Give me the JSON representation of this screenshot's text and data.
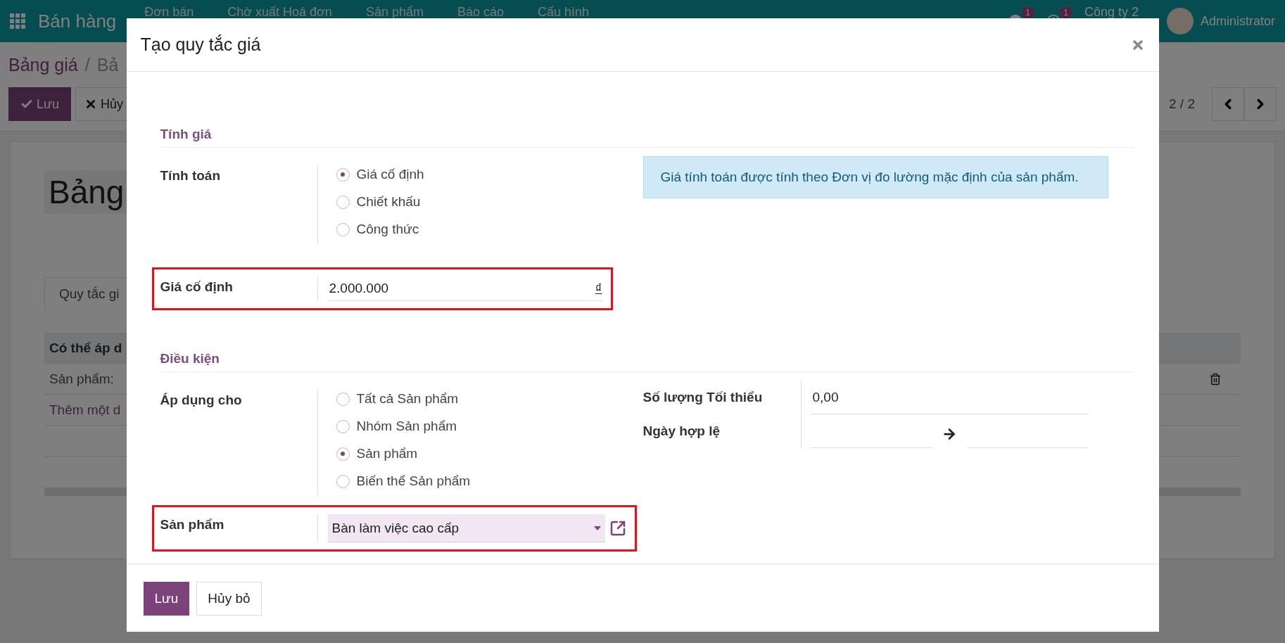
{
  "navbar": {
    "app_name": "Bán hàng",
    "menu": [
      "Đơn bán",
      "Chờ xuất Hoá đơn",
      "Sản phẩm",
      "Báo cáo",
      "Cấu hình"
    ],
    "chat_badge": "1",
    "activity_badge": "1",
    "company": "Công ty 2",
    "user": "Administrator"
  },
  "background": {
    "breadcrumb": [
      "Bảng giá",
      "/",
      "Bả"
    ],
    "buttons": [
      {
        "label": "Lưu",
        "kind": "primary"
      },
      {
        "label": "Hủy",
        "kind": "secondary"
      }
    ],
    "pager": "2 / 2",
    "title": "Bảng",
    "tab": "Quy tắc gi",
    "table": {
      "column_1": "Có thể áp d",
      "rows": [
        "Sản phẩm:"
      ],
      "add_line": "Thêm một d"
    }
  },
  "dialog": {
    "title": "Tạo quy tắc giá",
    "pricing": {
      "title": "Tính giá",
      "compute": {
        "label": "Tính toán",
        "options": [
          {
            "label": "Giá cố định",
            "selected": true
          },
          {
            "label": "Chiết khấu",
            "selected": false
          },
          {
            "label": "Công thức",
            "selected": false
          }
        ]
      },
      "info": "Giá tính toán được tính theo Đơn vị đo lường mặc định của sản phẩm.",
      "fixed_price": {
        "label": "Giá cố định",
        "value": "2.000.000",
        "currency": "₫",
        "highlighted": true
      }
    },
    "conditions": {
      "title": "Điều kiện",
      "apply_on": {
        "label": "Áp dụng cho",
        "options": [
          {
            "label": "Tất cả Sản phẩm",
            "selected": false
          },
          {
            "label": "Nhóm Sản phẩm",
            "selected": false
          },
          {
            "label": "Sản phẩm",
            "selected": true
          },
          {
            "label": "Biến thể Sản phẩm",
            "selected": false
          }
        ]
      },
      "min_quantity": {
        "label": "Số lượng Tối thiểu",
        "value": "0,00"
      },
      "validity": {
        "label": "Ngày hợp lệ"
      },
      "product": {
        "label": "Sản phẩm",
        "value": "Bàn làm việc cao cấp",
        "highlighted": true
      }
    },
    "buttons": [
      {
        "label": "Lưu",
        "kind": "primary"
      },
      {
        "label": "Hủy bỏ",
        "kind": "secondary"
      }
    ]
  }
}
